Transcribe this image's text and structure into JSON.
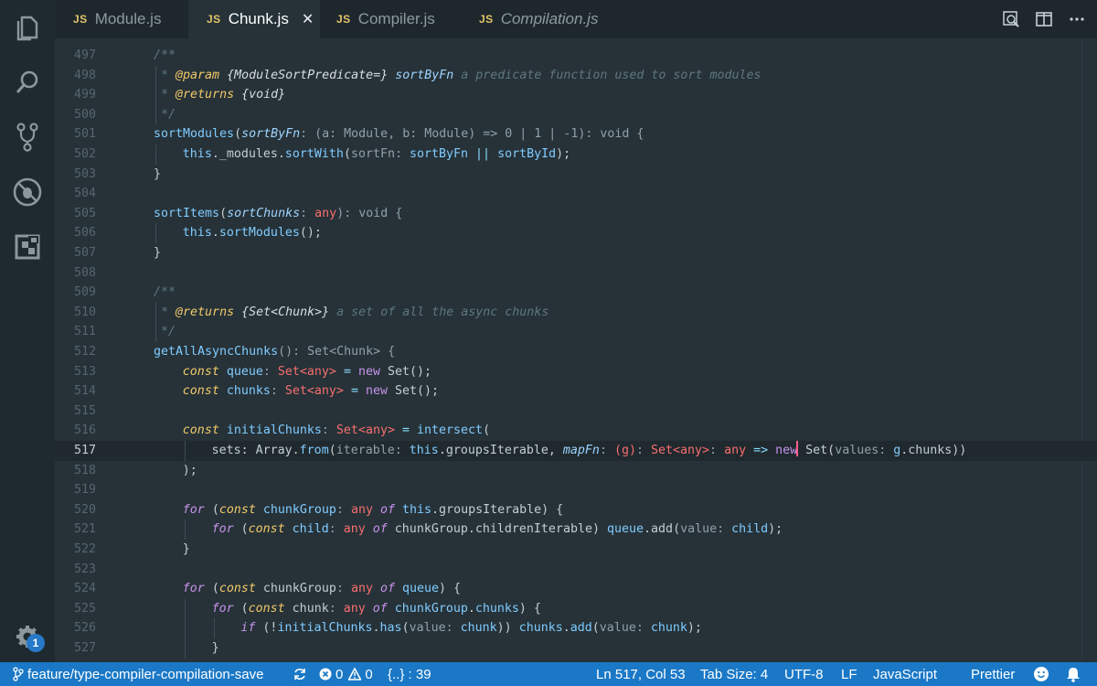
{
  "tabs": [
    {
      "badge": "JS",
      "label": "Module.js",
      "active": false
    },
    {
      "badge": "JS",
      "label": "Chunk.js",
      "active": true,
      "close": "✕"
    },
    {
      "badge": "JS",
      "label": "Compiler.js",
      "active": false
    },
    {
      "badge": "JS",
      "label": "Compilation.js",
      "active": false,
      "italic": true
    }
  ],
  "activity": {
    "icons": [
      "files-icon",
      "search-icon",
      "source-control-icon",
      "debug-icon",
      "extensions-icon",
      "gear-icon"
    ],
    "settings_badge": "1"
  },
  "editor": {
    "current_line": "517",
    "lines": [
      {
        "n": "497"
      },
      {
        "n": "498"
      },
      {
        "n": "499"
      },
      {
        "n": "500"
      },
      {
        "n": "501"
      },
      {
        "n": "502"
      },
      {
        "n": "503"
      },
      {
        "n": "504"
      },
      {
        "n": "505"
      },
      {
        "n": "506"
      },
      {
        "n": "507"
      },
      {
        "n": "508"
      },
      {
        "n": "509"
      },
      {
        "n": "510"
      },
      {
        "n": "511"
      },
      {
        "n": "512"
      },
      {
        "n": "513"
      },
      {
        "n": "514"
      },
      {
        "n": "515"
      },
      {
        "n": "516"
      },
      {
        "n": "517"
      },
      {
        "n": "518"
      },
      {
        "n": "519"
      },
      {
        "n": "520"
      },
      {
        "n": "521"
      },
      {
        "n": "522"
      },
      {
        "n": "523"
      },
      {
        "n": "524"
      },
      {
        "n": "525"
      },
      {
        "n": "526"
      },
      {
        "n": "527"
      }
    ],
    "code": {
      "c497": "/**",
      "c498_a": " * ",
      "c498_tag": "@param",
      "c498_type": " {ModuleSortPredicate=}",
      "c498_name": " sortByFn",
      "c498_desc": " a predicate function used to sort modules",
      "c499_a": " * ",
      "c499_tag": "@returns",
      "c499_type": " {void}",
      "c500": " */",
      "c501": [
        "sortModules",
        "(",
        "sortByFn",
        ": (a: Module, b: Module) => 0 | 1 | -1): void {"
      ],
      "c502": [
        "this",
        "._modules.",
        "sortWith",
        "(",
        "sortFn: ",
        "sortByFn",
        " || ",
        "sortById",
        ");"
      ],
      "c503": "}",
      "c505": [
        "sortItems",
        "(",
        "sortChunks",
        ": ",
        "any",
        "): void {"
      ],
      "c506": [
        "this",
        ".",
        "sortModules",
        "();"
      ],
      "c507": "}",
      "c509": "/**",
      "c510_a": " * ",
      "c510_tag": "@returns",
      "c510_type": " {Set<Chunk>}",
      "c510_desc": " a set of all the async chunks",
      "c511": " */",
      "c512": [
        "getAllAsyncChunks",
        "(): Set<Chunk> {"
      ],
      "c513": [
        "const",
        " queue",
        ": ",
        "Set<any>",
        " = ",
        "new",
        " Set();"
      ],
      "c514": [
        "const",
        " chunks",
        ": ",
        "Set<any>",
        " = ",
        "new",
        " Set();"
      ],
      "c516": [
        "const",
        " initialChunks",
        ": ",
        "Set<any>",
        " = ",
        "intersect",
        "("
      ],
      "c517": [
        "sets: Array.",
        "from",
        "(",
        "iterable: ",
        "this",
        ".groupsIterable, ",
        "mapFn",
        ": ",
        "(g)",
        ": ",
        "Set<any>",
        ": ",
        "any",
        " => ",
        "new",
        " Set(",
        "values: ",
        "g",
        ".chunks))"
      ],
      "c518": ");",
      "c520": [
        "for",
        " (",
        "const",
        " chunkGroup",
        ": ",
        "any",
        " of ",
        "this",
        ".groupsIterable) {"
      ],
      "c521": [
        "for",
        " (",
        "const",
        " child",
        ": ",
        "any",
        " of ",
        "chunkGroup",
        ".",
        "childrenIterable",
        ") ",
        "queue",
        ".",
        "add",
        "(",
        "value: ",
        "child",
        ");"
      ],
      "c522": "}",
      "c524": [
        "for",
        " (",
        "const",
        " chunkGroup",
        ": ",
        "any",
        " of ",
        "queue",
        ") {"
      ],
      "c525": [
        "for",
        " (",
        "const",
        " chunk",
        ": ",
        "any",
        " of ",
        "chunkGroup",
        ".",
        "chunks",
        ") {"
      ],
      "c526": [
        "if",
        " (!",
        "initialChunks",
        ".",
        "has",
        "(",
        "value: ",
        "chunk",
        ")) ",
        "chunks",
        ".",
        "add",
        "(",
        "value: ",
        "chunk",
        ");"
      ],
      "c527": "}"
    }
  },
  "status": {
    "branch": "feature/type-compiler-compilation-save",
    "errors": "0",
    "warnings": "0",
    "bracket_info": "{..} : 39",
    "position": "Ln 517, Col 53",
    "tab_size": "Tab Size: 4",
    "encoding": "UTF-8",
    "eol": "LF",
    "language": "JavaScript",
    "formatter": "Prettier",
    "notifications_count": "1"
  },
  "colors": {
    "accent": "#1a78c6",
    "editor_bg": "#263238",
    "js_badge": "#e3c46a"
  }
}
